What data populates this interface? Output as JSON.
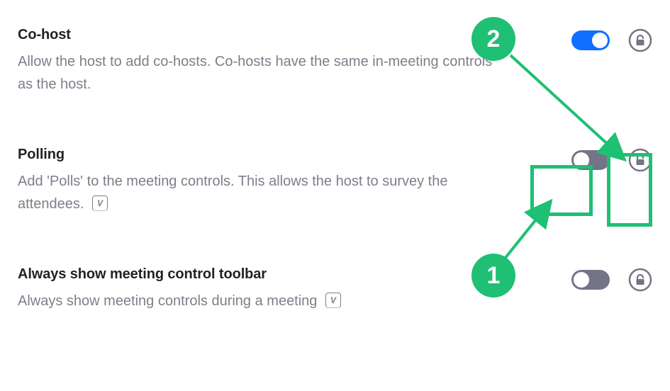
{
  "settings": [
    {
      "key": "cohost",
      "title": "Co-host",
      "description": "Allow the host to add co-hosts. Co-hosts have the same in-meeting controls as the host.",
      "toggle": "on",
      "has_vbadge": false
    },
    {
      "key": "polling",
      "title": "Polling",
      "description": "Add 'Polls' to the meeting controls. This allows the host to survey the attendees.",
      "toggle": "off",
      "has_vbadge": true
    },
    {
      "key": "toolbar",
      "title": "Always show meeting control toolbar",
      "description": "Always show meeting controls during a meeting",
      "toggle": "off",
      "has_vbadge": true
    }
  ],
  "vbadge_glyph": "V",
  "annotations": {
    "badge1": "1",
    "badge2": "2"
  },
  "colors": {
    "accent": "#1fbf74",
    "toggle_on": "#0f6fff",
    "toggle_off": "#747487"
  }
}
